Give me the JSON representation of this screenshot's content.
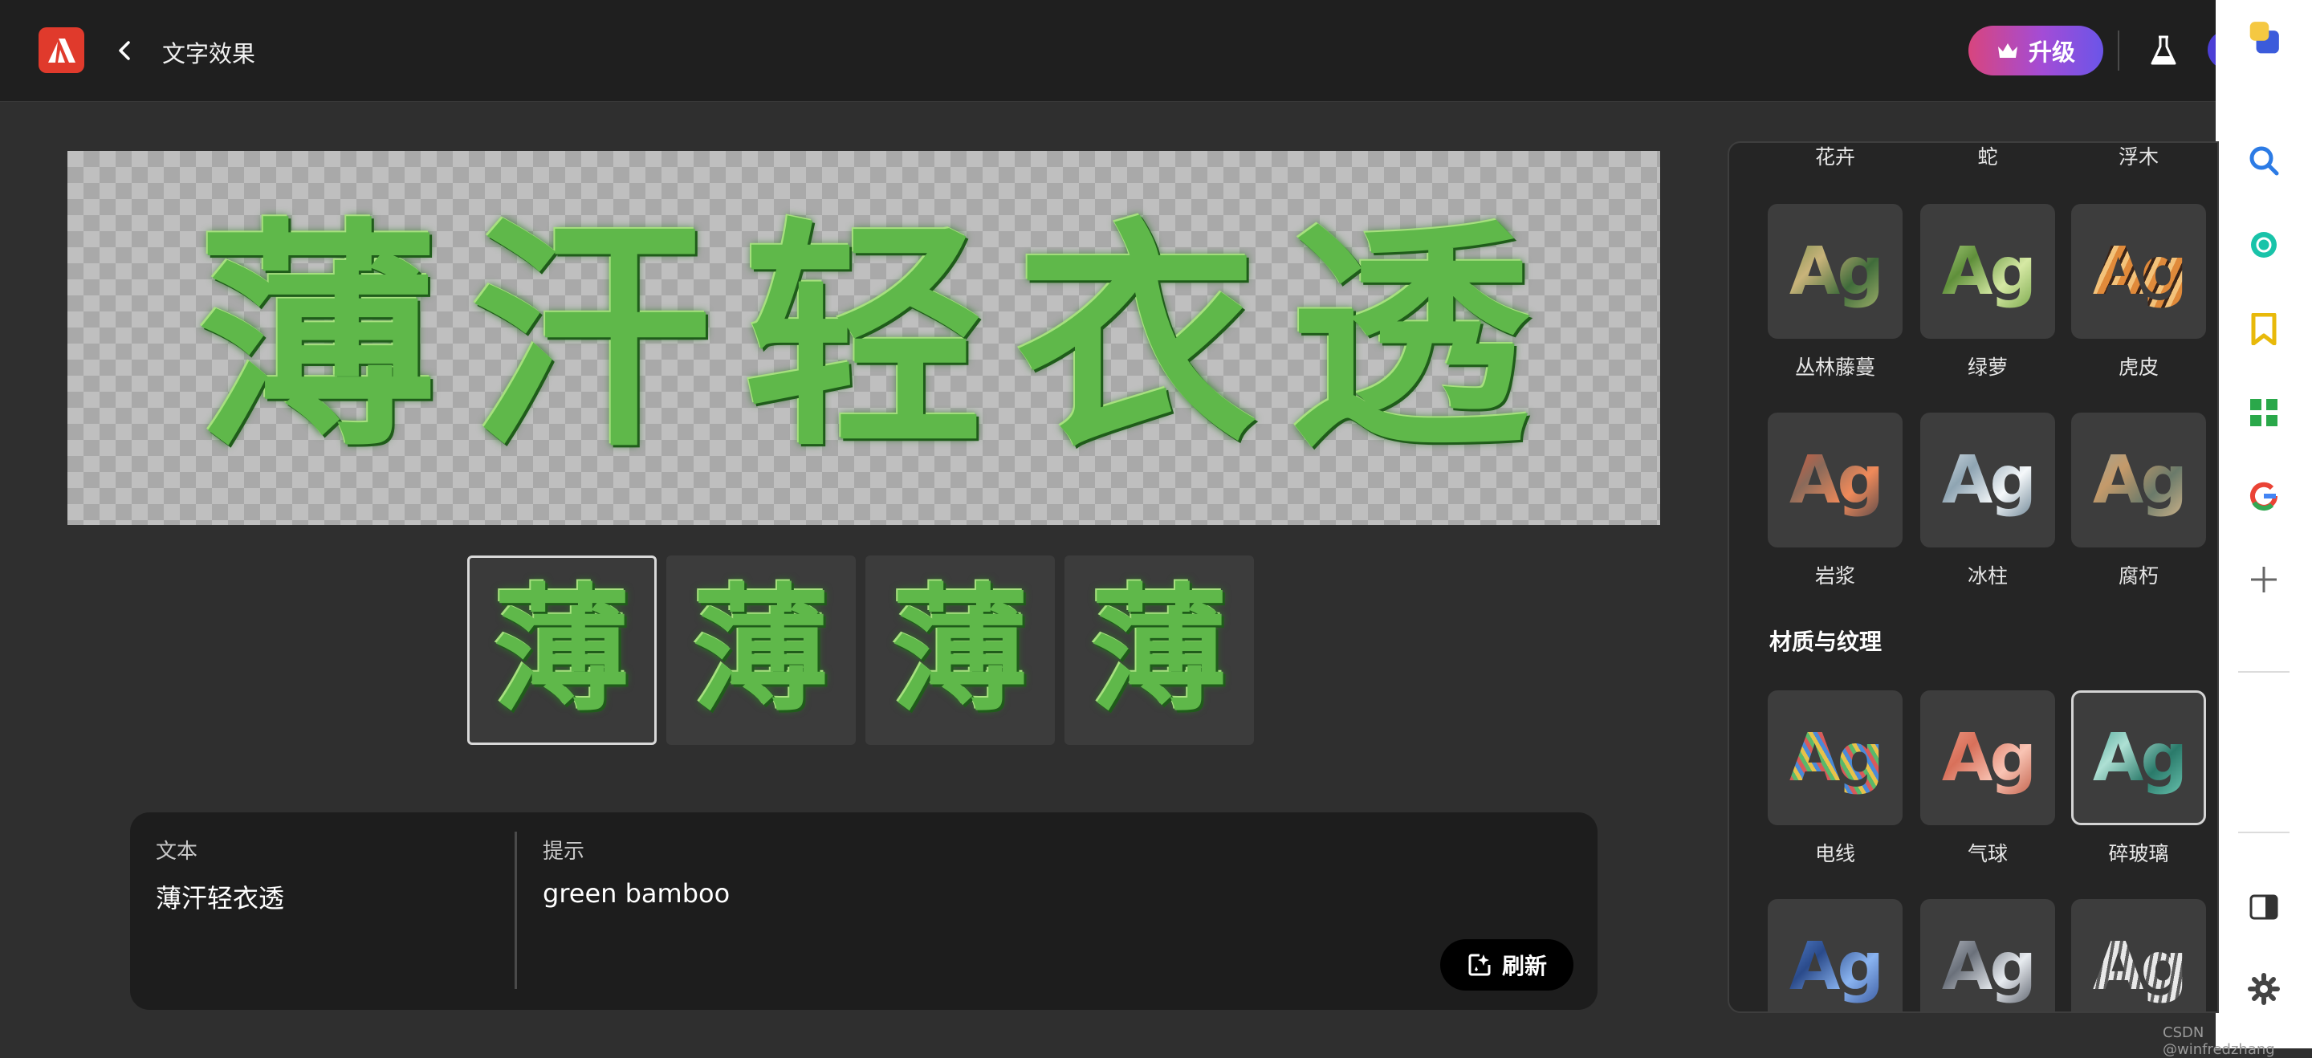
{
  "header": {
    "title": "文字效果",
    "upgrade_label": "升级"
  },
  "canvas": {
    "text": [
      "薄",
      "汗",
      "轻",
      "衣",
      "透"
    ],
    "fill_color": "#5fb84a"
  },
  "variations": {
    "glyph": "薄",
    "count": 4,
    "selected_index": 0
  },
  "input_panel": {
    "text_label": "文本",
    "text_value": "薄汗轻衣透",
    "prompt_label": "提示",
    "prompt_value": "green bamboo",
    "refresh_label": "刷新"
  },
  "style_panel": {
    "top_labels": [
      "花卉",
      "蛇",
      "浮木"
    ],
    "row1": [
      "丛林藤蔓",
      "绿萝",
      "虎皮"
    ],
    "row2": [
      "岩浆",
      "冰柱",
      "腐朽"
    ],
    "section_title": "材质与纹理",
    "row3": [
      "电线",
      "气球",
      "碎玻璃"
    ],
    "tile_text": "Ag",
    "selected": "碎玻璃"
  },
  "browser_sidebar": {
    "icons": [
      "app-icon",
      "search-icon",
      "openai-icon",
      "bookmark-icon",
      "grid-icon",
      "google-icon",
      "add-icon",
      "sidebar-toggle-icon",
      "settings-icon"
    ]
  },
  "watermark": "CSDN @winfredzhang"
}
